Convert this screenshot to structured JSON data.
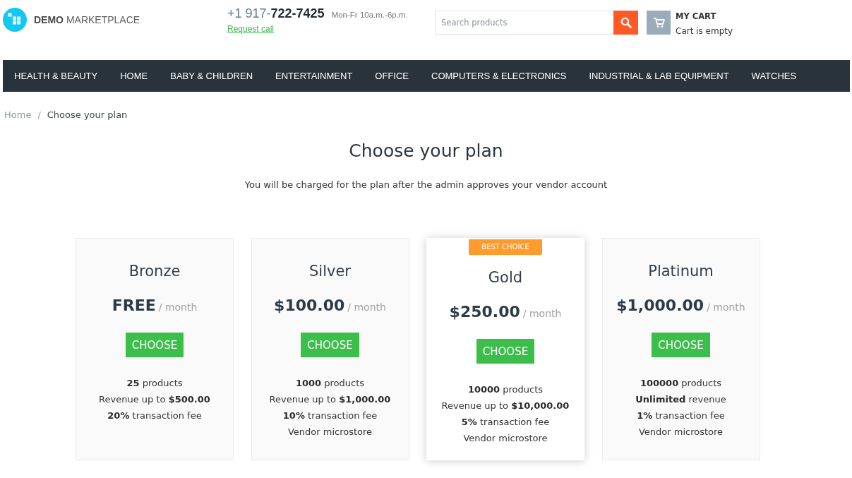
{
  "header": {
    "logo": "**DEMO** MARKETPLACE",
    "phone": "+1 917-**722-7425**",
    "hours": "Mon-Fr 10a.m.-6p.m.",
    "request_call": "Request call",
    "search": {
      "placeholder": "Search products"
    },
    "cart": {
      "title": "MY CART",
      "status": "Cart is empty"
    }
  },
  "nav": {
    "items": [
      "HEALTH & BEAUTY",
      "HOME",
      "BABY & CHILDREN",
      "ENTERTAINMENT",
      "OFFICE",
      "COMPUTERS & ELECTRONICS",
      "INDUSTRIAL & LAB EQUIPMENT",
      "WATCHES"
    ]
  },
  "breadcrumb": {
    "separator": "/",
    "items": [
      {
        "label": "Home",
        "kind": "link"
      },
      {
        "label": "Choose your plan",
        "kind": "current"
      }
    ]
  },
  "page": {
    "title": "Choose your plan",
    "subtitle": "You will be charged for the plan after the admin approves your vendor account"
  },
  "plans": [
    {
      "name": "Bronze",
      "price": "FREE",
      "period": "/ month",
      "button": "CHOOSE",
      "featured": false,
      "features": [
        "**25** products",
        "Revenue up to **$500.00**",
        "**20%** transaction fee"
      ]
    },
    {
      "name": "Silver",
      "price": "$100.00",
      "period": "/ month",
      "button": "CHOOSE",
      "featured": false,
      "features": [
        "**1000** products",
        "Revenue up to **$1,000.00**",
        "**10%** transaction fee",
        "Vendor microstore"
      ]
    },
    {
      "name": "Gold",
      "price": "$250.00",
      "period": "/ month",
      "button": "CHOOSE",
      "featured": true,
      "badge": "BEST CHOICE",
      "features": [
        "**10000** products",
        "Revenue up to **$10,000.00**",
        "**5%** transaction fee",
        "Vendor microstore"
      ]
    },
    {
      "name": "Platinum",
      "price": "$1,000.00",
      "period": "/ month",
      "button": "CHOOSE",
      "featured": false,
      "features": [
        "**100000** products",
        "**Unlimited** revenue",
        "**1%** transaction fee",
        "Vendor microstore"
      ]
    }
  ]
}
